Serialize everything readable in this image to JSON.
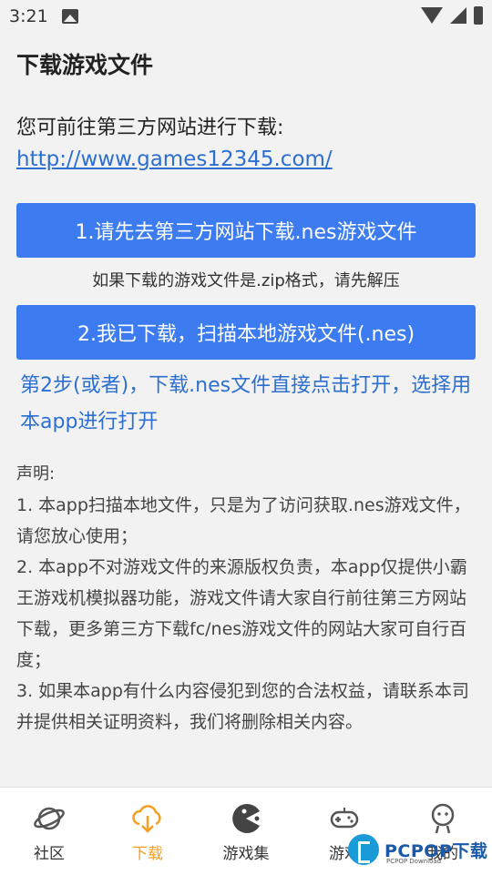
{
  "status_bar": {
    "time": "3:21"
  },
  "header": {
    "title": "下载游戏文件"
  },
  "main": {
    "intro": "您可前往第三方网站进行下载:",
    "link": "http://www.games12345.com/",
    "download_button": "1.请先去第三方网站下载.nes游戏文件",
    "zip_hint": "如果下载的游戏文件是.zip格式，请先解压",
    "scan_button": "2.我已下载，扫描本地游戏文件(.nes)",
    "step2_hint": "第2步(或者)，下载.nes文件直接点击打开，选择用本app进行打开",
    "statement_heading": "声明:",
    "statements": [
      "1. 本app扫描本地文件，只是为了访问获取.nes游戏文件，请您放心使用；",
      "2. 本app不对游戏文件的来源版权负责，本app仅提供小霸王游戏机模拟器功能，游戏文件请大家自行前往第三方网站下载，更多第三方下载fc/nes游戏文件的网站大家可自行百度；",
      "3. 如果本app有什么内容侵犯到您的合法权益，请联系本司并提供相关证明资料，我们将删除相关内容。"
    ]
  },
  "bottom_nav": {
    "items": [
      {
        "label": "社区",
        "icon": "planet-icon",
        "active": false
      },
      {
        "label": "下载",
        "icon": "cloud-download-icon",
        "active": true
      },
      {
        "label": "游戏集",
        "icon": "pacman-icon",
        "active": false
      },
      {
        "label": "游戏",
        "icon": "gamepad-icon",
        "active": false
      },
      {
        "label": "我的",
        "icon": "user-icon",
        "active": false
      }
    ]
  },
  "watermark": {
    "text": "PCPOP下载",
    "sub": "PCPOP Download"
  },
  "colors": {
    "accent": "#3c7cf0",
    "link": "#2d6fd0",
    "active_tab": "#f5a020"
  }
}
